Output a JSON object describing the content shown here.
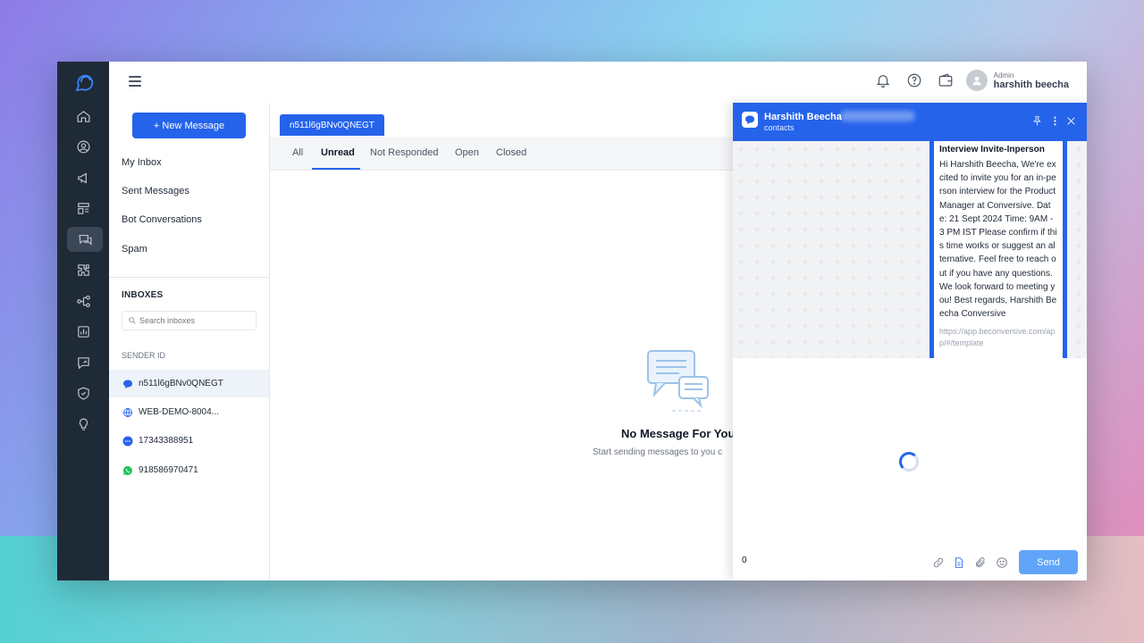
{
  "topbar": {
    "user_role": "Admin",
    "user_name": "harshith beecha"
  },
  "sidebar": {
    "new_message_label": "+ New Message",
    "nav": [
      "My Inbox",
      "Sent Messages",
      "Bot Conversations",
      "Spam"
    ],
    "inboxes_heading": "INBOXES",
    "search_placeholder": "Search inboxes",
    "sender_heading": "SENDER ID",
    "senders": [
      {
        "label": "n511l6gBNv0QNEGT",
        "icon": "chat-bubble-icon",
        "active": true
      },
      {
        "label": "WEB-DEMO-8004...",
        "icon": "globe-icon",
        "active": false
      },
      {
        "label": "17343388951",
        "icon": "sms-icon",
        "active": false
      },
      {
        "label": "918586970471",
        "icon": "whatsapp-icon",
        "active": false
      }
    ]
  },
  "main": {
    "sender_tab": "n511l6gBNv0QNEGT",
    "tabs": [
      "All",
      "Unread",
      "Not Responded",
      "Open",
      "Closed"
    ],
    "active_tab": "Unread",
    "empty_title": "No Message For You",
    "empty_subtitle": "Start sending messages to you c"
  },
  "chat": {
    "contact_name": "Harshith Beecha",
    "contact_subtitle": "contacts",
    "message_title": "Interview Invite-Inperson",
    "message_body": "Hi Harshith Beecha, We're excited to invite you for an in-person interview for the Product Manager at Conversive. Date: 21 Sept 2024 Time: 9AM - 3 PM IST Please confirm if this time works or suggest an alternative. Feel free to reach out if you have any questions. We look forward to meeting you! Best regards, Harshith Beecha Conversive",
    "message_link": "https://app.beconversive.com/app/#/template",
    "composer_value": "0",
    "send_label": "Send"
  },
  "colors": {
    "accent": "#2563eb",
    "rail": "#1f2a37",
    "send_disabled": "#60a5fa"
  }
}
